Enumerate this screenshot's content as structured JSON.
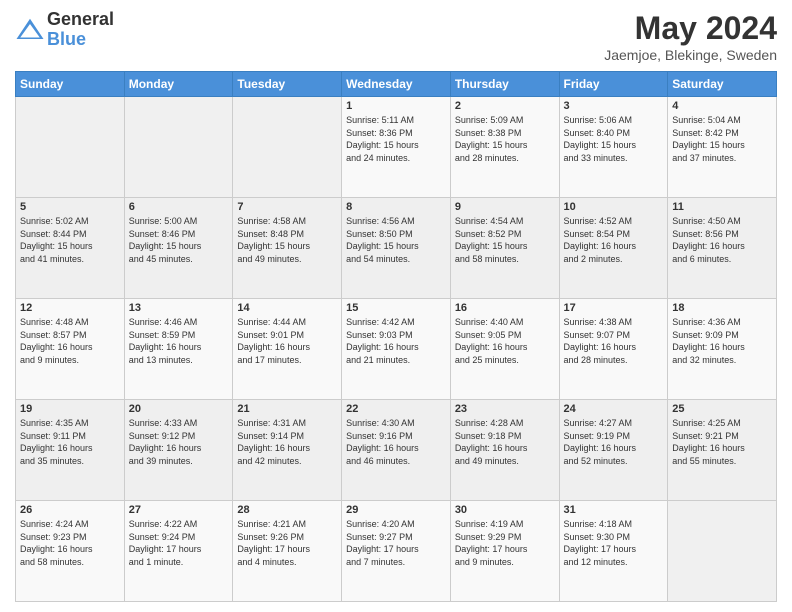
{
  "logo": {
    "general": "General",
    "blue": "Blue"
  },
  "header": {
    "month": "May 2024",
    "location": "Jaemjoe, Blekinge, Sweden"
  },
  "weekdays": [
    "Sunday",
    "Monday",
    "Tuesday",
    "Wednesday",
    "Thursday",
    "Friday",
    "Saturday"
  ],
  "weeks": [
    [
      {
        "day": "",
        "info": ""
      },
      {
        "day": "",
        "info": ""
      },
      {
        "day": "",
        "info": ""
      },
      {
        "day": "1",
        "info": "Sunrise: 5:11 AM\nSunset: 8:36 PM\nDaylight: 15 hours\nand 24 minutes."
      },
      {
        "day": "2",
        "info": "Sunrise: 5:09 AM\nSunset: 8:38 PM\nDaylight: 15 hours\nand 28 minutes."
      },
      {
        "day": "3",
        "info": "Sunrise: 5:06 AM\nSunset: 8:40 PM\nDaylight: 15 hours\nand 33 minutes."
      },
      {
        "day": "4",
        "info": "Sunrise: 5:04 AM\nSunset: 8:42 PM\nDaylight: 15 hours\nand 37 minutes."
      }
    ],
    [
      {
        "day": "5",
        "info": "Sunrise: 5:02 AM\nSunset: 8:44 PM\nDaylight: 15 hours\nand 41 minutes."
      },
      {
        "day": "6",
        "info": "Sunrise: 5:00 AM\nSunset: 8:46 PM\nDaylight: 15 hours\nand 45 minutes."
      },
      {
        "day": "7",
        "info": "Sunrise: 4:58 AM\nSunset: 8:48 PM\nDaylight: 15 hours\nand 49 minutes."
      },
      {
        "day": "8",
        "info": "Sunrise: 4:56 AM\nSunset: 8:50 PM\nDaylight: 15 hours\nand 54 minutes."
      },
      {
        "day": "9",
        "info": "Sunrise: 4:54 AM\nSunset: 8:52 PM\nDaylight: 15 hours\nand 58 minutes."
      },
      {
        "day": "10",
        "info": "Sunrise: 4:52 AM\nSunset: 8:54 PM\nDaylight: 16 hours\nand 2 minutes."
      },
      {
        "day": "11",
        "info": "Sunrise: 4:50 AM\nSunset: 8:56 PM\nDaylight: 16 hours\nand 6 minutes."
      }
    ],
    [
      {
        "day": "12",
        "info": "Sunrise: 4:48 AM\nSunset: 8:57 PM\nDaylight: 16 hours\nand 9 minutes."
      },
      {
        "day": "13",
        "info": "Sunrise: 4:46 AM\nSunset: 8:59 PM\nDaylight: 16 hours\nand 13 minutes."
      },
      {
        "day": "14",
        "info": "Sunrise: 4:44 AM\nSunset: 9:01 PM\nDaylight: 16 hours\nand 17 minutes."
      },
      {
        "day": "15",
        "info": "Sunrise: 4:42 AM\nSunset: 9:03 PM\nDaylight: 16 hours\nand 21 minutes."
      },
      {
        "day": "16",
        "info": "Sunrise: 4:40 AM\nSunset: 9:05 PM\nDaylight: 16 hours\nand 25 minutes."
      },
      {
        "day": "17",
        "info": "Sunrise: 4:38 AM\nSunset: 9:07 PM\nDaylight: 16 hours\nand 28 minutes."
      },
      {
        "day": "18",
        "info": "Sunrise: 4:36 AM\nSunset: 9:09 PM\nDaylight: 16 hours\nand 32 minutes."
      }
    ],
    [
      {
        "day": "19",
        "info": "Sunrise: 4:35 AM\nSunset: 9:11 PM\nDaylight: 16 hours\nand 35 minutes."
      },
      {
        "day": "20",
        "info": "Sunrise: 4:33 AM\nSunset: 9:12 PM\nDaylight: 16 hours\nand 39 minutes."
      },
      {
        "day": "21",
        "info": "Sunrise: 4:31 AM\nSunset: 9:14 PM\nDaylight: 16 hours\nand 42 minutes."
      },
      {
        "day": "22",
        "info": "Sunrise: 4:30 AM\nSunset: 9:16 PM\nDaylight: 16 hours\nand 46 minutes."
      },
      {
        "day": "23",
        "info": "Sunrise: 4:28 AM\nSunset: 9:18 PM\nDaylight: 16 hours\nand 49 minutes."
      },
      {
        "day": "24",
        "info": "Sunrise: 4:27 AM\nSunset: 9:19 PM\nDaylight: 16 hours\nand 52 minutes."
      },
      {
        "day": "25",
        "info": "Sunrise: 4:25 AM\nSunset: 9:21 PM\nDaylight: 16 hours\nand 55 minutes."
      }
    ],
    [
      {
        "day": "26",
        "info": "Sunrise: 4:24 AM\nSunset: 9:23 PM\nDaylight: 16 hours\nand 58 minutes."
      },
      {
        "day": "27",
        "info": "Sunrise: 4:22 AM\nSunset: 9:24 PM\nDaylight: 17 hours\nand 1 minute."
      },
      {
        "day": "28",
        "info": "Sunrise: 4:21 AM\nSunset: 9:26 PM\nDaylight: 17 hours\nand 4 minutes."
      },
      {
        "day": "29",
        "info": "Sunrise: 4:20 AM\nSunset: 9:27 PM\nDaylight: 17 hours\nand 7 minutes."
      },
      {
        "day": "30",
        "info": "Sunrise: 4:19 AM\nSunset: 9:29 PM\nDaylight: 17 hours\nand 9 minutes."
      },
      {
        "day": "31",
        "info": "Sunrise: 4:18 AM\nSunset: 9:30 PM\nDaylight: 17 hours\nand 12 minutes."
      },
      {
        "day": "",
        "info": ""
      }
    ]
  ]
}
